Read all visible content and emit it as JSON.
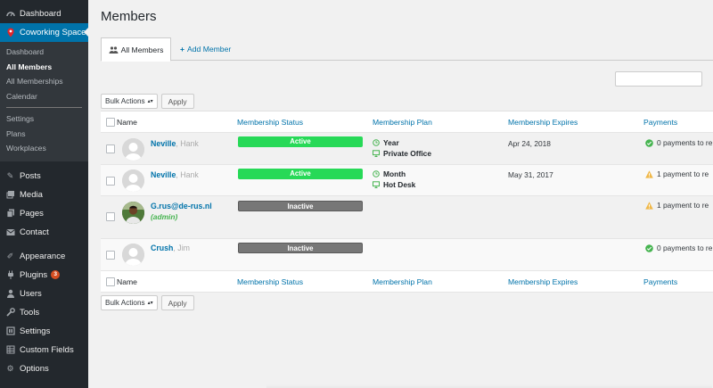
{
  "sidebar": {
    "items": [
      {
        "label": "Dashboard",
        "icon": "dashboard-icon"
      },
      {
        "label": "Coworking Space",
        "icon": "location-pin-icon",
        "current": true
      }
    ],
    "submenu": [
      "Dashboard",
      "All Members",
      "All Memberships",
      "Calendar",
      "Settings",
      "Plans",
      "Workplaces"
    ],
    "lower_items": [
      {
        "label": "Posts",
        "icon": "pin-icon"
      },
      {
        "label": "Media",
        "icon": "media-icon"
      },
      {
        "label": "Pages",
        "icon": "pages-icon"
      },
      {
        "label": "Contact",
        "icon": "mail-icon"
      },
      {
        "label": "Appearance",
        "icon": "brush-icon"
      },
      {
        "label": "Plugins",
        "icon": "plugin-icon",
        "badge": "3"
      },
      {
        "label": "Users",
        "icon": "users-icon"
      },
      {
        "label": "Tools",
        "icon": "wrench-icon"
      },
      {
        "label": "Settings",
        "icon": "settings-icon"
      },
      {
        "label": "Custom Fields",
        "icon": "grid-icon"
      },
      {
        "label": "Options",
        "icon": "gear-icon"
      }
    ]
  },
  "page": {
    "title": "Members",
    "tabs": {
      "all_members": "All Members",
      "add_member": "Add Member"
    },
    "search_value": "",
    "bulk_actions": "Bulk Actions",
    "apply": "Apply"
  },
  "table": {
    "headers": {
      "name": "Name",
      "status": "Membership Status",
      "plan": "Membership Plan",
      "expires": "Membership Expires",
      "payments": "Payments"
    },
    "rows": [
      {
        "first": "Neville",
        "last": ", Hank",
        "status": "Active",
        "plan_period": "Year",
        "plan_name": "Private Office",
        "expires": "Apr 24, 2018",
        "payments": "0 payments to re",
        "payment_state": "ok"
      },
      {
        "first": "Neville",
        "last": ", Hank",
        "status": "Active",
        "plan_period": "Month",
        "plan_name": "Hot Desk",
        "expires": "May 31, 2017",
        "payments": "1 payment to re",
        "payment_state": "warning"
      },
      {
        "first": "G.rus@de-rus.nl",
        "last": "",
        "role": "(admin)",
        "status": "Inactive",
        "payments": "1 payment to re",
        "payment_state": "warning"
      },
      {
        "first": "Crush",
        "last": ", Jim",
        "status": "Inactive",
        "payments": "0 payments to re",
        "payment_state": "ok"
      }
    ]
  },
  "colors": {
    "accent": "#0073aa",
    "active": "#27d957",
    "inactive": "#777777",
    "sidebar": "#23282d",
    "warning": "#f0b849",
    "ok": "#46b450"
  }
}
